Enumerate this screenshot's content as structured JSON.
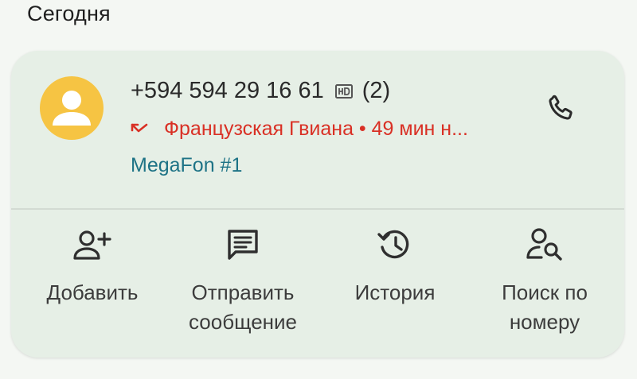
{
  "section": {
    "title": "Сегодня"
  },
  "contact": {
    "number": "+594 594 29 16 61",
    "call_count": "(2)",
    "location_time": "Французская Гвиана • 49 мин н...",
    "sim": "MegaFon #1",
    "avatar_color": "#f6c443",
    "missed_color": "#d93025",
    "sim_color": "#1e7386"
  },
  "actions": {
    "add": "Добавить",
    "message": "Отправить\nсообщение",
    "history": "История",
    "search": "Поиск по\nномеру"
  },
  "icons": {
    "avatar": "person-icon",
    "hd": "hd-icon",
    "missed": "missed-call-icon",
    "call": "phone-icon",
    "add": "add-contact-icon",
    "message": "message-icon",
    "history": "history-icon",
    "search": "person-search-icon"
  }
}
